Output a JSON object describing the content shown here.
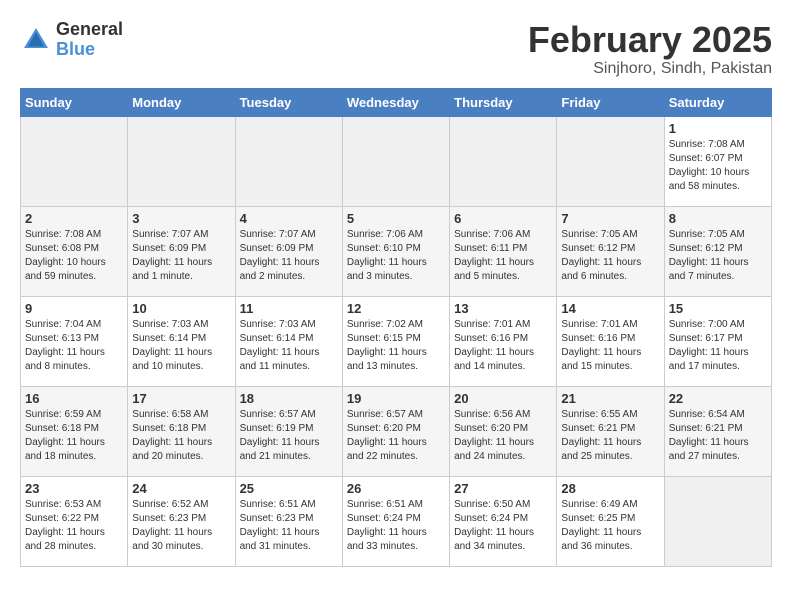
{
  "logo": {
    "general": "General",
    "blue": "Blue"
  },
  "header": {
    "month": "February 2025",
    "location": "Sinjhoro, Sindh, Pakistan"
  },
  "weekdays": [
    "Sunday",
    "Monday",
    "Tuesday",
    "Wednesday",
    "Thursday",
    "Friday",
    "Saturday"
  ],
  "weeks": [
    [
      {
        "day": "",
        "info": ""
      },
      {
        "day": "",
        "info": ""
      },
      {
        "day": "",
        "info": ""
      },
      {
        "day": "",
        "info": ""
      },
      {
        "day": "",
        "info": ""
      },
      {
        "day": "",
        "info": ""
      },
      {
        "day": "1",
        "info": "Sunrise: 7:08 AM\nSunset: 6:07 PM\nDaylight: 10 hours\nand 58 minutes."
      }
    ],
    [
      {
        "day": "2",
        "info": "Sunrise: 7:08 AM\nSunset: 6:08 PM\nDaylight: 10 hours\nand 59 minutes."
      },
      {
        "day": "3",
        "info": "Sunrise: 7:07 AM\nSunset: 6:09 PM\nDaylight: 11 hours\nand 1 minute."
      },
      {
        "day": "4",
        "info": "Sunrise: 7:07 AM\nSunset: 6:09 PM\nDaylight: 11 hours\nand 2 minutes."
      },
      {
        "day": "5",
        "info": "Sunrise: 7:06 AM\nSunset: 6:10 PM\nDaylight: 11 hours\nand 3 minutes."
      },
      {
        "day": "6",
        "info": "Sunrise: 7:06 AM\nSunset: 6:11 PM\nDaylight: 11 hours\nand 5 minutes."
      },
      {
        "day": "7",
        "info": "Sunrise: 7:05 AM\nSunset: 6:12 PM\nDaylight: 11 hours\nand 6 minutes."
      },
      {
        "day": "8",
        "info": "Sunrise: 7:05 AM\nSunset: 6:12 PM\nDaylight: 11 hours\nand 7 minutes."
      }
    ],
    [
      {
        "day": "9",
        "info": "Sunrise: 7:04 AM\nSunset: 6:13 PM\nDaylight: 11 hours\nand 8 minutes."
      },
      {
        "day": "10",
        "info": "Sunrise: 7:03 AM\nSunset: 6:14 PM\nDaylight: 11 hours\nand 10 minutes."
      },
      {
        "day": "11",
        "info": "Sunrise: 7:03 AM\nSunset: 6:14 PM\nDaylight: 11 hours\nand 11 minutes."
      },
      {
        "day": "12",
        "info": "Sunrise: 7:02 AM\nSunset: 6:15 PM\nDaylight: 11 hours\nand 13 minutes."
      },
      {
        "day": "13",
        "info": "Sunrise: 7:01 AM\nSunset: 6:16 PM\nDaylight: 11 hours\nand 14 minutes."
      },
      {
        "day": "14",
        "info": "Sunrise: 7:01 AM\nSunset: 6:16 PM\nDaylight: 11 hours\nand 15 minutes."
      },
      {
        "day": "15",
        "info": "Sunrise: 7:00 AM\nSunset: 6:17 PM\nDaylight: 11 hours\nand 17 minutes."
      }
    ],
    [
      {
        "day": "16",
        "info": "Sunrise: 6:59 AM\nSunset: 6:18 PM\nDaylight: 11 hours\nand 18 minutes."
      },
      {
        "day": "17",
        "info": "Sunrise: 6:58 AM\nSunset: 6:18 PM\nDaylight: 11 hours\nand 20 minutes."
      },
      {
        "day": "18",
        "info": "Sunrise: 6:57 AM\nSunset: 6:19 PM\nDaylight: 11 hours\nand 21 minutes."
      },
      {
        "day": "19",
        "info": "Sunrise: 6:57 AM\nSunset: 6:20 PM\nDaylight: 11 hours\nand 22 minutes."
      },
      {
        "day": "20",
        "info": "Sunrise: 6:56 AM\nSunset: 6:20 PM\nDaylight: 11 hours\nand 24 minutes."
      },
      {
        "day": "21",
        "info": "Sunrise: 6:55 AM\nSunset: 6:21 PM\nDaylight: 11 hours\nand 25 minutes."
      },
      {
        "day": "22",
        "info": "Sunrise: 6:54 AM\nSunset: 6:21 PM\nDaylight: 11 hours\nand 27 minutes."
      }
    ],
    [
      {
        "day": "23",
        "info": "Sunrise: 6:53 AM\nSunset: 6:22 PM\nDaylight: 11 hours\nand 28 minutes."
      },
      {
        "day": "24",
        "info": "Sunrise: 6:52 AM\nSunset: 6:23 PM\nDaylight: 11 hours\nand 30 minutes."
      },
      {
        "day": "25",
        "info": "Sunrise: 6:51 AM\nSunset: 6:23 PM\nDaylight: 11 hours\nand 31 minutes."
      },
      {
        "day": "26",
        "info": "Sunrise: 6:51 AM\nSunset: 6:24 PM\nDaylight: 11 hours\nand 33 minutes."
      },
      {
        "day": "27",
        "info": "Sunrise: 6:50 AM\nSunset: 6:24 PM\nDaylight: 11 hours\nand 34 minutes."
      },
      {
        "day": "28",
        "info": "Sunrise: 6:49 AM\nSunset: 6:25 PM\nDaylight: 11 hours\nand 36 minutes."
      },
      {
        "day": "",
        "info": ""
      }
    ]
  ]
}
